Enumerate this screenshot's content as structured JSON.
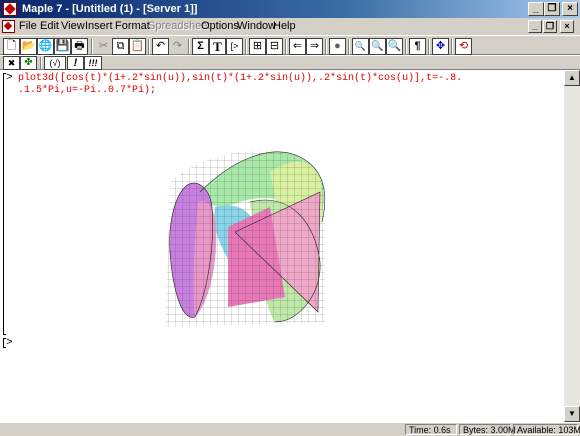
{
  "window": {
    "title": "Maple 7 - [Untitled (1) - [Server 1]]",
    "controls": {
      "minimize": "_",
      "restore": "❐",
      "close": "×"
    }
  },
  "menubar": {
    "items": [
      {
        "label": "File",
        "enabled": true
      },
      {
        "label": "Edit",
        "enabled": true
      },
      {
        "label": "View",
        "enabled": true
      },
      {
        "label": "Insert",
        "enabled": true
      },
      {
        "label": "Format",
        "enabled": true
      },
      {
        "label": "Spreadsheet",
        "enabled": false
      },
      {
        "label": "Options",
        "enabled": true
      },
      {
        "label": "Window",
        "enabled": true
      },
      {
        "label": "Help",
        "enabled": true
      }
    ],
    "mdi_controls": {
      "minimize": "_",
      "restore": "❐",
      "close": "×"
    }
  },
  "toolbar1": {
    "tools": [
      {
        "name": "new-icon",
        "glyph": "🗋"
      },
      {
        "name": "open-icon",
        "glyph": "📂"
      },
      {
        "name": "open-url-icon",
        "glyph": "🌐"
      },
      {
        "name": "save-icon",
        "glyph": "💾"
      },
      {
        "name": "print-icon",
        "glyph": "🖶"
      },
      {
        "name": "cut-icon",
        "glyph": "✂"
      },
      {
        "name": "copy-icon",
        "glyph": "⧉"
      },
      {
        "name": "paste-icon",
        "glyph": "📋"
      },
      {
        "name": "undo-icon",
        "glyph": "↶"
      },
      {
        "name": "redo-icon",
        "glyph": "↷"
      },
      {
        "name": "sum-icon",
        "glyph": "Σ"
      },
      {
        "name": "text-icon",
        "glyph": "T"
      },
      {
        "name": "prompt-icon",
        "glyph": "[>"
      },
      {
        "name": "group-icon",
        "glyph": "⊞"
      },
      {
        "name": "ungroup-icon",
        "glyph": "⊟"
      },
      {
        "name": "back-icon",
        "glyph": "⇐"
      },
      {
        "name": "forward-icon",
        "glyph": "⇒"
      },
      {
        "name": "stop-icon",
        "glyph": "●"
      },
      {
        "name": "zoom-100-icon",
        "glyph": "🔍"
      },
      {
        "name": "zoom-150-icon",
        "glyph": "🔍"
      },
      {
        "name": "zoom-200-icon",
        "glyph": "🔍"
      },
      {
        "name": "pilcrow-icon",
        "glyph": "¶"
      },
      {
        "name": "expand-icon",
        "glyph": "✥"
      },
      {
        "name": "restart-icon",
        "glyph": "⟲"
      }
    ]
  },
  "toolbar2": {
    "tools": [
      {
        "name": "interrupt-icon",
        "glyph": "✖"
      },
      {
        "name": "debug-icon",
        "glyph": "✤"
      },
      {
        "name": "sqrt-icon",
        "glyph": "(√)"
      },
      {
        "name": "execute-icon",
        "glyph": "!"
      },
      {
        "name": "execute-all-icon",
        "glyph": "!!!"
      }
    ]
  },
  "document": {
    "input_prompt": ">",
    "input_lines": [
      "plot3d([cos(t)*(1+.2*sin(u)),sin(t)*(1+.2*sin(u)),.2*sin(t)*cos(u)],t=-.8.",
      ".1.5*Pi,u=-Pi..0.7*Pi);"
    ],
    "empty_prompt": ">"
  },
  "plot": {
    "type": "3d-surface",
    "colors": [
      "#c070e0",
      "#e870b8",
      "#f0a0c0",
      "#a0e0a0",
      "#80d0e8",
      "#d0f0a0"
    ]
  },
  "statusbar": {
    "time": "Time:   0.6s",
    "bytes": "Bytes: 3.00M",
    "available": "Available: 103M"
  }
}
